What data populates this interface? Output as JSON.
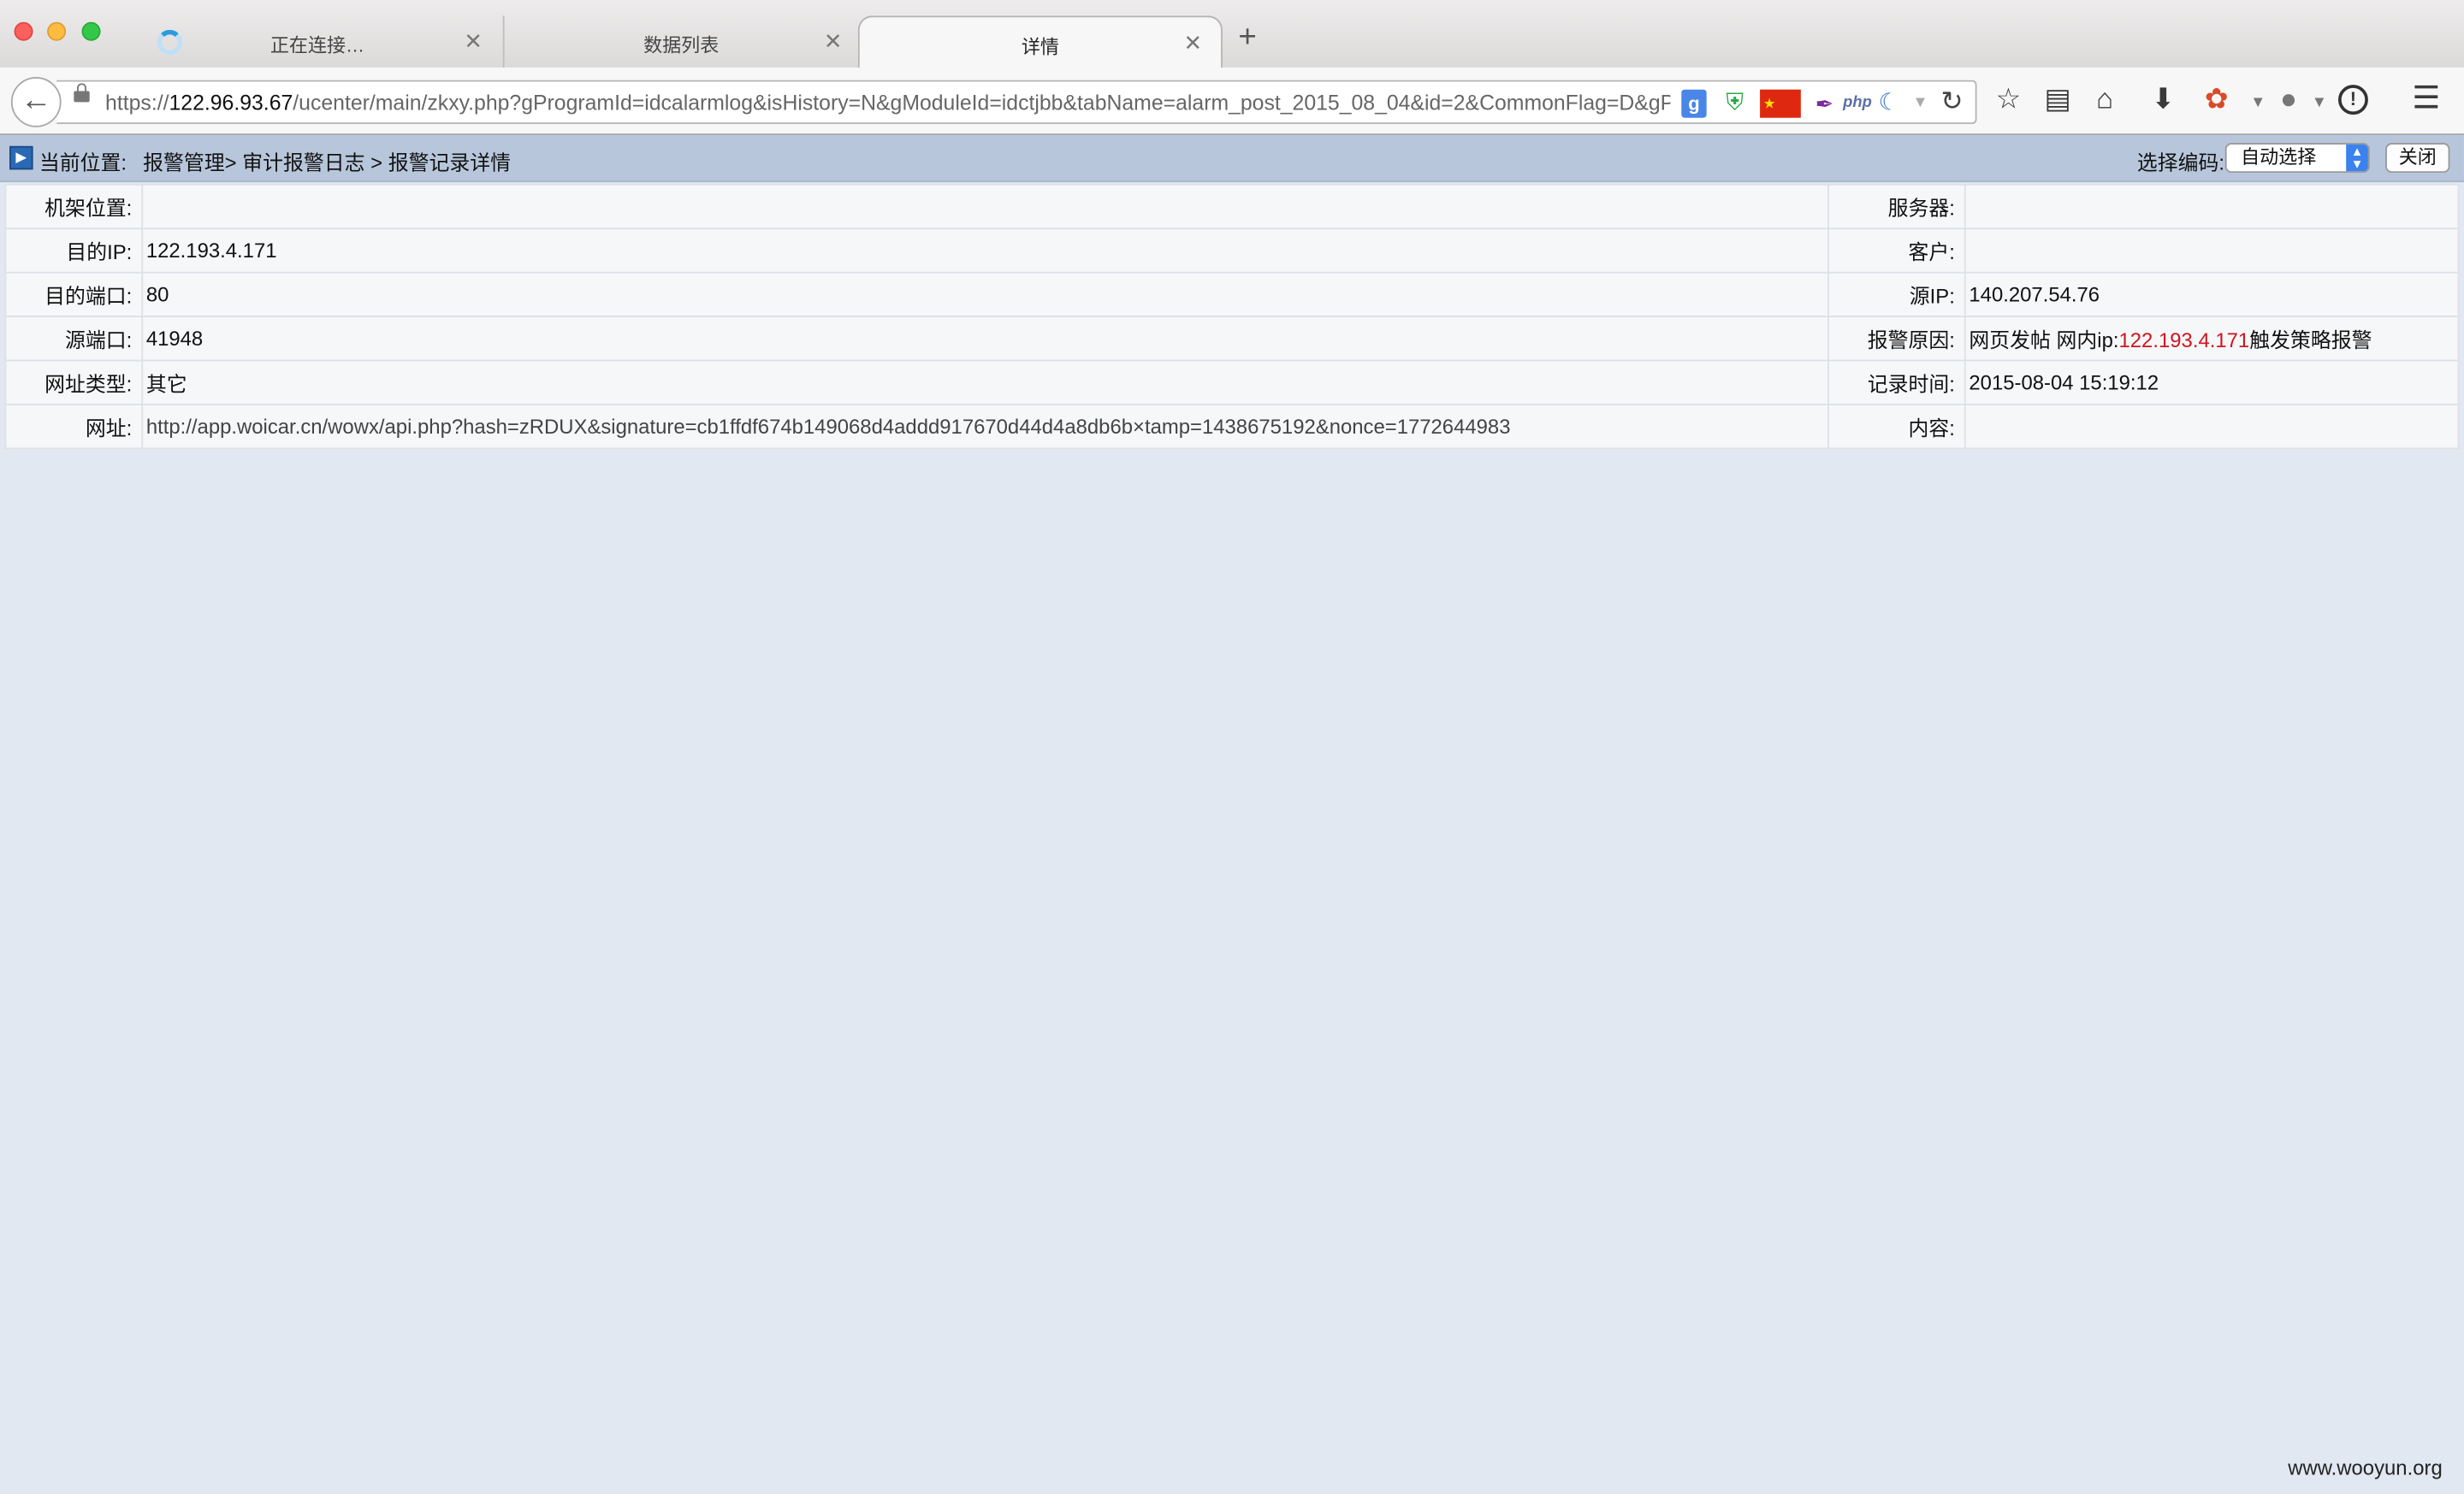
{
  "browser": {
    "tabs": [
      {
        "label": "正在连接…",
        "loading": true
      },
      {
        "label": "数据列表"
      },
      {
        "label": "详情",
        "active": true
      }
    ],
    "url": {
      "scheme": "https://",
      "host": "122.96.93.67",
      "path": "/ucenter/main/zkxy.php?gProgramId=idcalarmlog&isHistory=N&gModuleId=idctjbb&tabName=alarm_post_2015_08_04&id=2&CommonFlag=D&gPr"
    },
    "extensions": {
      "google": "g",
      "php": "php"
    }
  },
  "header": {
    "location_label": "当前位置:",
    "breadcrumb": "报警管理> 审计报警日志 > 报警记录详情",
    "encoding_label": "选择编码:",
    "encoding_selected": "自动选择",
    "close_label": "关闭"
  },
  "detail": {
    "rack_label": "机架位置:",
    "rack_value": "",
    "server_label": "服务器:",
    "server_value": "",
    "dest_ip_label": "目的IP:",
    "dest_ip_value": "122.193.4.171",
    "customer_label": "客户:",
    "customer_value": "",
    "dest_port_label": "目的端口:",
    "dest_port_value": "80",
    "src_ip_label": "源IP:",
    "src_ip_value": "140.207.54.76",
    "src_port_label": "源端口:",
    "src_port_value": "41948",
    "reason_label": "报警原因:",
    "reason_prefix": "网页发帖 网内ip:",
    "reason_ip": "122.193.4.171",
    "reason_suffix": "触发策略报警",
    "url_type_label": "网址类型:",
    "url_type_value": "其它",
    "record_time_label": "记录时间:",
    "record_time_value": "2015-08-04 15:19:12",
    "url_label": "网址:",
    "url_value": "http://app.woicar.cn/wowx/api.php?hash=zRDUX&signature=cb1ffdf674b149068d4addd917670d44d4a8db6b×tamp=1438675192&nonce=1772644983",
    "content_label": "内容:",
    "content_value": ""
  },
  "watermark": "www.wooyun.org",
  "colors": {
    "page_background": "#e1e8f2",
    "header_bar": "#b8c6db",
    "alarm_ip": "#d0151d",
    "select_arrow": "#3b82f0"
  }
}
